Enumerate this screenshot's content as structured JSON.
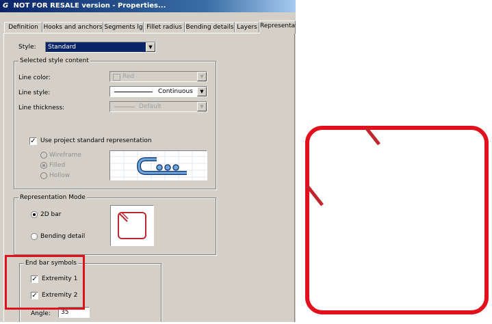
{
  "title": "NOT FOR RESALE version - Properties...",
  "title_icon": "G",
  "tabs": [
    "Definition",
    "Hooks and anchors",
    "Segments lg",
    "Fillet radius",
    "Bending details",
    "Layers",
    "Representation"
  ],
  "active_tab": "Representation",
  "style": {
    "label": "Style:",
    "value": "Standard"
  },
  "selected_style": {
    "title": "Selected style content",
    "line_color": {
      "label": "Line color:",
      "value": "Red"
    },
    "line_style": {
      "label": "Line style:",
      "value": "Continuous"
    },
    "line_thickness": {
      "label": "Line thickness:",
      "value": "Default"
    },
    "use_project": {
      "label": "Use project standard representation",
      "checked": true
    },
    "render_modes": [
      {
        "label": "Wireframe",
        "selected": false
      },
      {
        "label": "Filled",
        "selected": true
      },
      {
        "label": "Hollow",
        "selected": false
      }
    ]
  },
  "representation_mode": {
    "title": "Representation Mode",
    "options": [
      {
        "label": "2D bar",
        "selected": true
      },
      {
        "label": "Bending detail",
        "selected": false
      }
    ]
  },
  "end_bar_symbols": {
    "title": "End bar symbols",
    "extremity1": {
      "label": "Extremity 1",
      "checked": true
    },
    "extremity2": {
      "label": "Extremity 2",
      "checked": true
    },
    "angle": {
      "label": "Angle:",
      "value": "35"
    }
  },
  "colors": {
    "accent": "#e0101c",
    "bar_preview": "#c0272d",
    "title_bar": "#0a246a"
  }
}
